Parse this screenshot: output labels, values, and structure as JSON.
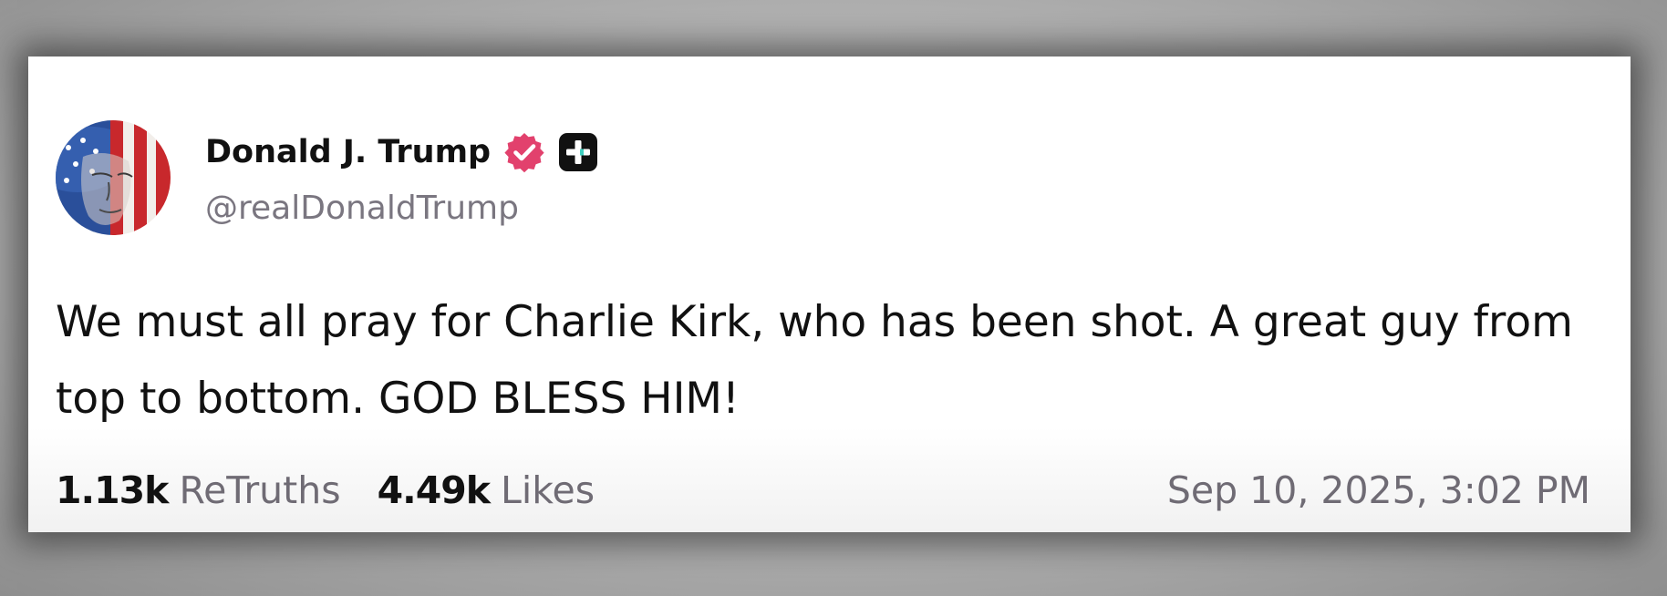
{
  "post": {
    "author": {
      "display_name": "Donald J. Trump",
      "handle": "@realDonaldTrump",
      "verified": true
    },
    "text": "We must all pray for Charlie Kirk, who has been shot. A great guy from top to bottom. GOD BLESS HIM!",
    "stats": {
      "retruths_count": "1.13k",
      "retruths_label": "ReTruths",
      "likes_count": "4.49k",
      "likes_label": "Likes"
    },
    "timestamp": "Sep 10, 2025, 3:02 PM"
  },
  "icons": {
    "verified": "verified-badge-icon",
    "plus": "plus-badge-icon",
    "avatar": "avatar-flag-portrait"
  },
  "colors": {
    "verified_badge": "#e2416d",
    "plus_badge_bg": "#111111",
    "muted_text": "#6f6b74",
    "primary_text": "#111111"
  }
}
